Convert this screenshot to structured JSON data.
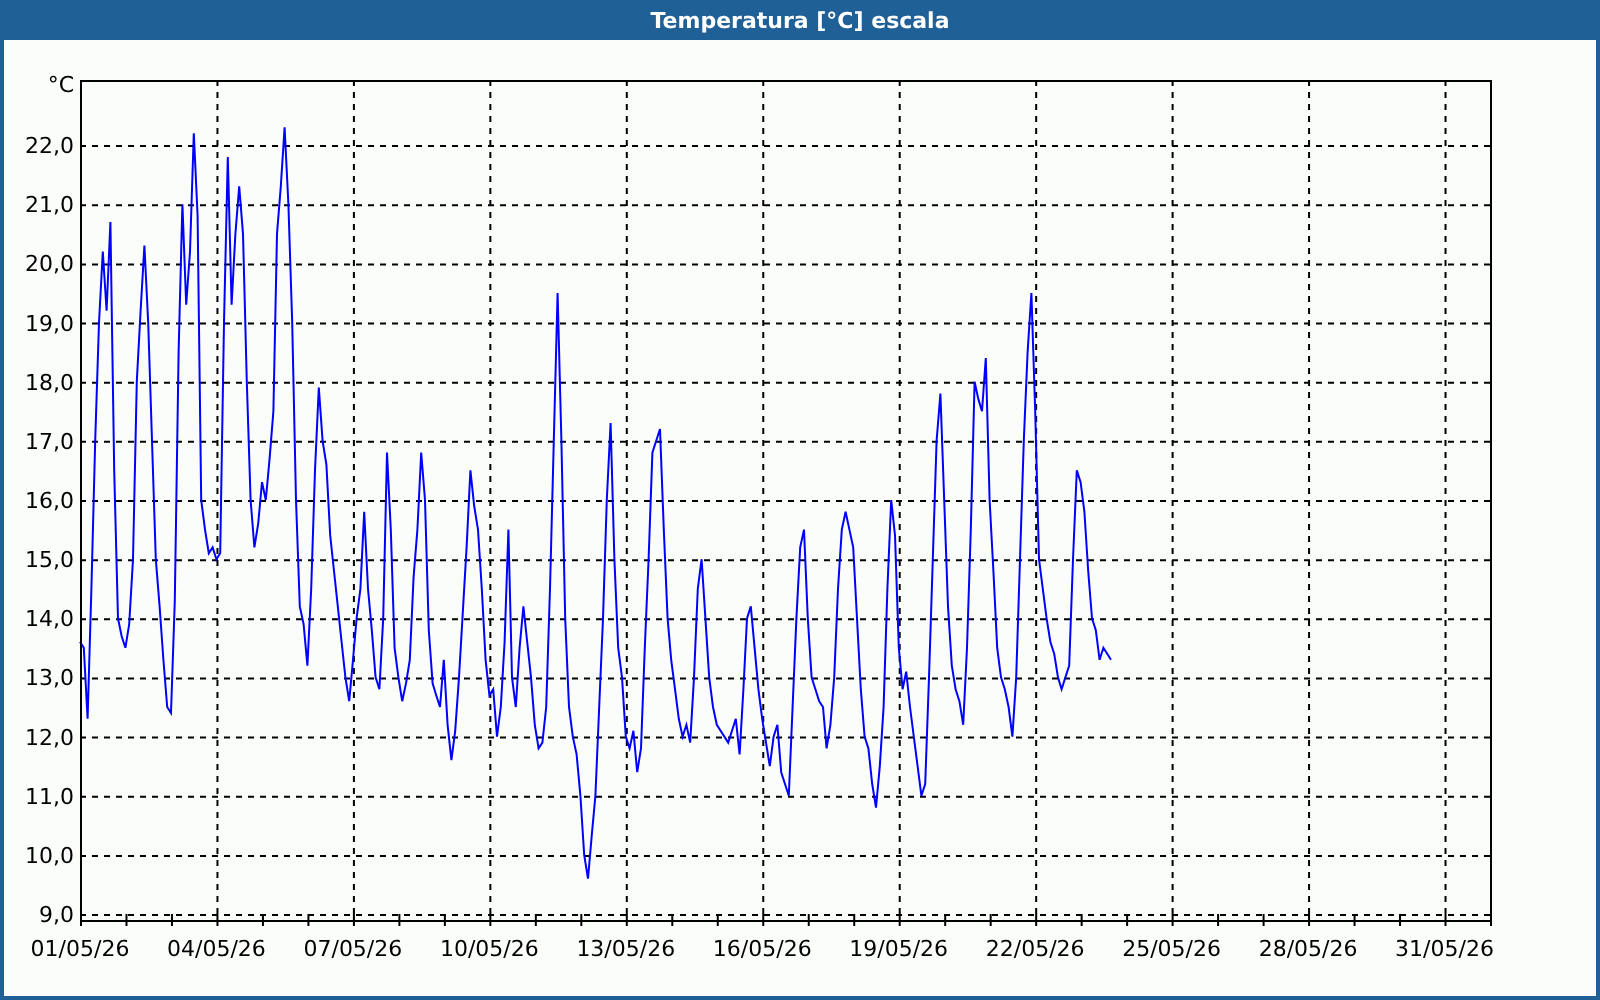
{
  "window": {
    "title": "Temperatura [°C] escala"
  },
  "chart_data": {
    "type": "line",
    "grid": true,
    "ylabel": "°C",
    "ylim": [
      8.9,
      23.1
    ],
    "yticks": [
      {
        "value": 9,
        "label": "9,0"
      },
      {
        "value": 10,
        "label": "10,0"
      },
      {
        "value": 11,
        "label": "11,0"
      },
      {
        "value": 12,
        "label": "12,0"
      },
      {
        "value": 13,
        "label": "13,0"
      },
      {
        "value": 14,
        "label": "14,0"
      },
      {
        "value": 15,
        "label": "15,0"
      },
      {
        "value": 16,
        "label": "16,0"
      },
      {
        "value": 17,
        "label": "17,0"
      },
      {
        "value": 18,
        "label": "18,0"
      },
      {
        "value": 19,
        "label": "19,0"
      },
      {
        "value": 20,
        "label": "20,0"
      },
      {
        "value": 21,
        "label": "21,0"
      },
      {
        "value": 22,
        "label": "22,0"
      }
    ],
    "categories": [
      "01/05/26",
      null,
      null,
      null,
      null,
      null,
      null,
      null,
      null,
      null,
      null,
      null,
      null,
      null,
      null,
      null,
      null,
      null,
      null,
      null,
      null,
      null,
      null,
      null,
      null,
      null,
      null,
      null,
      null,
      null,
      null,
      null,
      null,
      null,
      null,
      null,
      "04/05/26",
      null,
      null,
      null,
      null,
      null,
      null,
      null,
      null,
      null,
      null,
      null,
      null,
      null,
      null,
      null,
      null,
      null,
      null,
      null,
      null,
      null,
      null,
      null,
      null,
      null,
      null,
      null,
      null,
      null,
      null,
      null,
      null,
      null,
      null,
      null,
      "07/05/26",
      null,
      null,
      null,
      null,
      null,
      null,
      null,
      null,
      null,
      null,
      null,
      null,
      null,
      null,
      null,
      null,
      null,
      null,
      null,
      null,
      null,
      null,
      null,
      null,
      null,
      null,
      null,
      null,
      null,
      null,
      null,
      null,
      null,
      null,
      null,
      "10/05/26",
      null,
      null,
      null,
      null,
      null,
      null,
      null,
      null,
      null,
      null,
      null,
      null,
      null,
      null,
      null,
      null,
      null,
      null,
      null,
      null,
      null,
      null,
      null,
      null,
      null,
      null,
      null,
      null,
      null,
      null,
      null,
      null,
      null,
      null,
      null,
      "13/05/26",
      null,
      null,
      null,
      null,
      null,
      null,
      null,
      null,
      null,
      null,
      null,
      null,
      null,
      null,
      null,
      null,
      null,
      null,
      null,
      null,
      null,
      null,
      null,
      null,
      null,
      null,
      null,
      null,
      null,
      null,
      null,
      null,
      null,
      null,
      null,
      "16/05/26",
      null,
      null,
      null,
      null,
      null,
      null,
      null,
      null,
      null,
      null,
      null,
      null,
      null,
      null,
      null,
      null,
      null,
      null,
      null,
      null,
      null,
      null,
      null,
      null,
      null,
      null,
      null,
      null,
      null,
      null,
      null,
      null,
      null,
      null,
      null,
      "19/05/26",
      null,
      null,
      null,
      null,
      null,
      null,
      null,
      null,
      null,
      null,
      null,
      null,
      null,
      null,
      null,
      null,
      null,
      null,
      null,
      null,
      null,
      null,
      null,
      null,
      null,
      null,
      null,
      null,
      null,
      null,
      null,
      null,
      null,
      null,
      null,
      "22/05/26",
      null,
      null,
      null,
      null,
      null,
      null,
      null,
      null,
      null,
      null,
      null,
      null,
      null,
      null,
      null,
      null,
      null,
      null,
      null,
      null,
      null,
      null,
      null,
      null,
      null,
      null,
      null,
      null,
      null,
      null,
      null,
      null,
      null,
      null,
      null,
      "25/05/26",
      null,
      null,
      null,
      null,
      null,
      null,
      null,
      null,
      null,
      null,
      null,
      null,
      null,
      null,
      null,
      null,
      null,
      null,
      null,
      null,
      null,
      null,
      null,
      null,
      null,
      null,
      null,
      null,
      null,
      null,
      null,
      null,
      null,
      null,
      null,
      "28/05/26",
      null,
      null,
      null,
      null,
      null,
      null,
      null,
      null,
      null,
      null,
      null,
      null,
      null,
      null,
      null,
      null,
      null,
      null,
      null,
      null,
      null,
      null,
      null,
      null,
      null,
      null,
      null,
      null,
      null,
      null,
      null,
      null,
      null,
      null,
      null,
      "31/05/26",
      null,
      null,
      null,
      null,
      null,
      null,
      null,
      null,
      null,
      null,
      null,
      null
    ],
    "series": [
      {
        "color": "#0000ff",
        "values": [
          13.6,
          13.5,
          12.3,
          14.5,
          17,
          19,
          20.2,
          19.2,
          20.7,
          16.5,
          14,
          13.7,
          13.5,
          13.9,
          15,
          18,
          19.2,
          20.3,
          19,
          17,
          15,
          14.2,
          13.3,
          12.5,
          12.4,
          14.3,
          18.5,
          21,
          19.3,
          20.2,
          22.2,
          20.8,
          16,
          15.5,
          15.1,
          15.2,
          15,
          15.1,
          19,
          21.8,
          19.3,
          20.5,
          21.3,
          20.5,
          18,
          16,
          15.2,
          15.6,
          16.3,
          16,
          16.7,
          17.5,
          20.5,
          21.3,
          22.3,
          21,
          19,
          16,
          14.2,
          13.9,
          13.2,
          14.5,
          16.5,
          17.9,
          17,
          16.6,
          15.4,
          14.8,
          14.2,
          13.6,
          13,
          12.6,
          13.3,
          14,
          14.5,
          15.8,
          14.5,
          13.8,
          13,
          12.8,
          14,
          16.8,
          15.5,
          13.5,
          13,
          12.6,
          12.9,
          13.3,
          14.7,
          15.5,
          16.8,
          16,
          13.8,
          12.9,
          12.7,
          12.5,
          13.3,
          12.2,
          11.6,
          12.1,
          13,
          14.1,
          15.2,
          16.5,
          15.9,
          15.5,
          14.5,
          13.3,
          12.7,
          12.8,
          12,
          12.5,
          13.6,
          15.5,
          13,
          12.5,
          13.5,
          14.2,
          13.6,
          13,
          12.2,
          11.8,
          11.9,
          12.5,
          14.5,
          17,
          19.5,
          17,
          14,
          12.5,
          12,
          11.7,
          11,
          10,
          9.6,
          10.3,
          11,
          12.5,
          14,
          16,
          17.3,
          15,
          13.5,
          13,
          12,
          11.8,
          12.1,
          11.4,
          11.8,
          13.5,
          15,
          16.8,
          17,
          17.2,
          15.5,
          14,
          13.3,
          12.8,
          12.3,
          12,
          12.2,
          11.9,
          13,
          14.5,
          15,
          14,
          13,
          12.5,
          12.2,
          12.1,
          12,
          11.9,
          12.1,
          12.3,
          11.7,
          12.8,
          14,
          14.2,
          13.5,
          12.8,
          12.3,
          11.9,
          11.5,
          12,
          12.2,
          11.4,
          11.2,
          11,
          12.5,
          14,
          15.2,
          15.5,
          14,
          13,
          12.8,
          12.6,
          12.5,
          11.8,
          12.2,
          13,
          14.5,
          15.5,
          15.8,
          15.5,
          15.2,
          14,
          12.8,
          12,
          11.8,
          11.2,
          10.8,
          11.5,
          12.5,
          14.5,
          16,
          15.4,
          13.5,
          12.8,
          13.1,
          12.5,
          12,
          11.5,
          11,
          11.2,
          13,
          15,
          17,
          17.8,
          16,
          14.2,
          13.2,
          12.8,
          12.6,
          12.2,
          13.5,
          15.5,
          18,
          17.7,
          17.5,
          18.4,
          16,
          14.8,
          13.5,
          13,
          12.8,
          12.5,
          12,
          13,
          15,
          17,
          18.5,
          19.5,
          17.5,
          15,
          14.5,
          14,
          13.6,
          13.4,
          13,
          12.8,
          13,
          13.2,
          15,
          16.5,
          16.3,
          15.8,
          14.8,
          14,
          13.8,
          13.3,
          13.5,
          13.4,
          13.3,
          null,
          null,
          null,
          null,
          null,
          null,
          null,
          null,
          null,
          null,
          null,
          null,
          null,
          null,
          null,
          null,
          null,
          null,
          null,
          null,
          null,
          null,
          null,
          null,
          null,
          null,
          null,
          null,
          null,
          null,
          null,
          null,
          null,
          null,
          null,
          null,
          null,
          null,
          null,
          null,
          null,
          null,
          null,
          null,
          null,
          null,
          null,
          null,
          null,
          null,
          null,
          null,
          null,
          null,
          null,
          null,
          null,
          null,
          null,
          null,
          null,
          null,
          null,
          null,
          null,
          null,
          null,
          null,
          null,
          null,
          null,
          null,
          null,
          null,
          null,
          null,
          null,
          null,
          null,
          null,
          null,
          null,
          null,
          null,
          null,
          null,
          null,
          null,
          null,
          null,
          null,
          null,
          null,
          null,
          null,
          null,
          null,
          null,
          null,
          null
        ]
      }
    ]
  }
}
